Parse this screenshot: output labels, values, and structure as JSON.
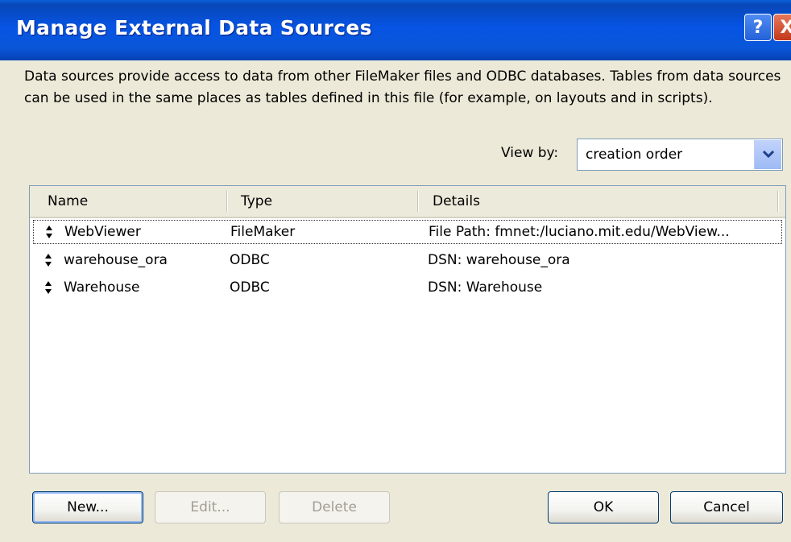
{
  "window": {
    "title": "Manage External Data Sources",
    "help_glyph": "?",
    "close_glyph": "X"
  },
  "description": "Data sources provide access to data from other FileMaker files and ODBC databases. Tables from data sources can be used in the same places as tables defined in this file (for example, on layouts and in scripts).",
  "view_by": {
    "label": "View by:",
    "selected": "creation order"
  },
  "list": {
    "columns": [
      "Name",
      "Type",
      "Details"
    ],
    "rows": [
      {
        "name": "WebViewer",
        "type": "FileMaker",
        "details": "File Path: fmnet:/luciano.mit.edu/WebView..."
      },
      {
        "name": "warehouse_ora",
        "type": "ODBC",
        "details": "DSN: warehouse_ora"
      },
      {
        "name": "Warehouse",
        "type": "ODBC",
        "details": "DSN: Warehouse"
      }
    ]
  },
  "buttons": {
    "new": "New...",
    "edit": "Edit...",
    "delete": "Delete",
    "ok": "OK",
    "cancel": "Cancel"
  },
  "icons": {
    "row_handle": "drag-handle-icon",
    "dropdown": "chevron-down-icon"
  },
  "colors": {
    "titlebar": "#0654e4",
    "dialog_bg": "#ece9d8",
    "close_button": "#c3381c"
  }
}
